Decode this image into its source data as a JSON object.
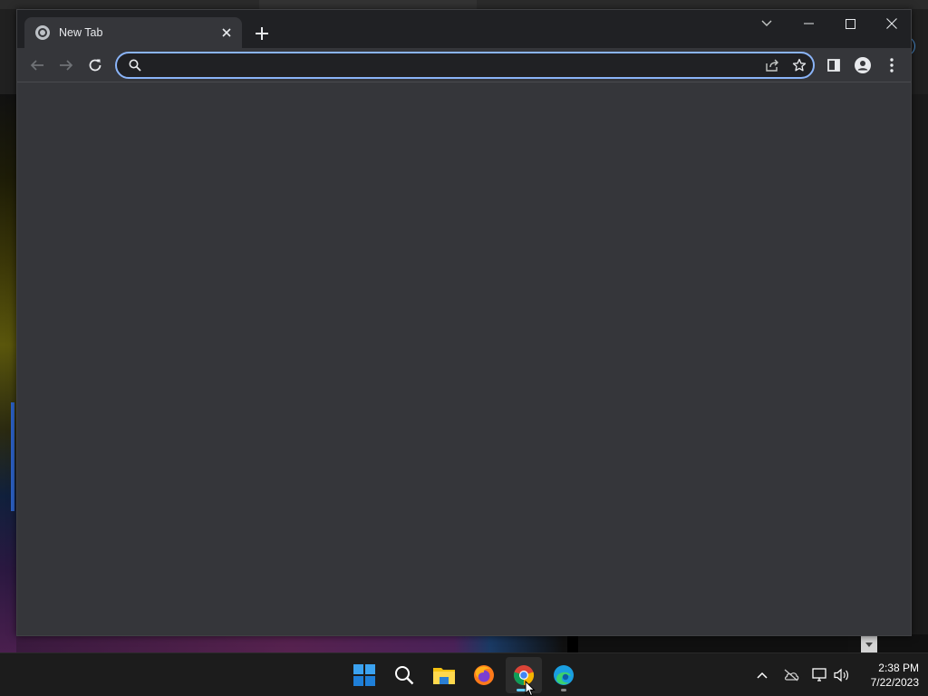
{
  "browser": {
    "tab": {
      "title": "New Tab"
    },
    "omnibox": {
      "value": "",
      "placeholder": ""
    },
    "icons": {
      "tab_favicon": "chrome-logo-icon",
      "tab_close": "close-icon",
      "new_tab": "plus-icon",
      "tab_search": "chevron-down-icon",
      "minimize": "minimize-icon",
      "maximize": "maximize-icon",
      "close": "close-icon",
      "back": "arrow-left-icon",
      "forward": "arrow-right-icon",
      "reload": "reload-icon",
      "search": "search-icon",
      "share": "share-icon",
      "bookmark": "star-icon",
      "side_panel": "side-panel-icon",
      "profile": "person-icon",
      "menu": "kebab-menu-icon"
    }
  },
  "taskbar": {
    "apps": [
      "start-windows-icon",
      "search-icon",
      "file-explorer-icon",
      "firefox-icon",
      "chrome-icon",
      "edge-icon"
    ],
    "active_app": "chrome",
    "tray": [
      "chevron-up-icon",
      "onedrive-offline-icon",
      "network-icon",
      "volume-icon"
    ],
    "clock": {
      "time": "2:38 PM",
      "date": "7/22/2023"
    }
  },
  "colors": {
    "titlebar": "#202124",
    "toolbar": "#35363a",
    "omnibox_focus": "#8ab4f8",
    "taskbar": "#1c1c1c",
    "active_indicator": "#60cdff"
  }
}
